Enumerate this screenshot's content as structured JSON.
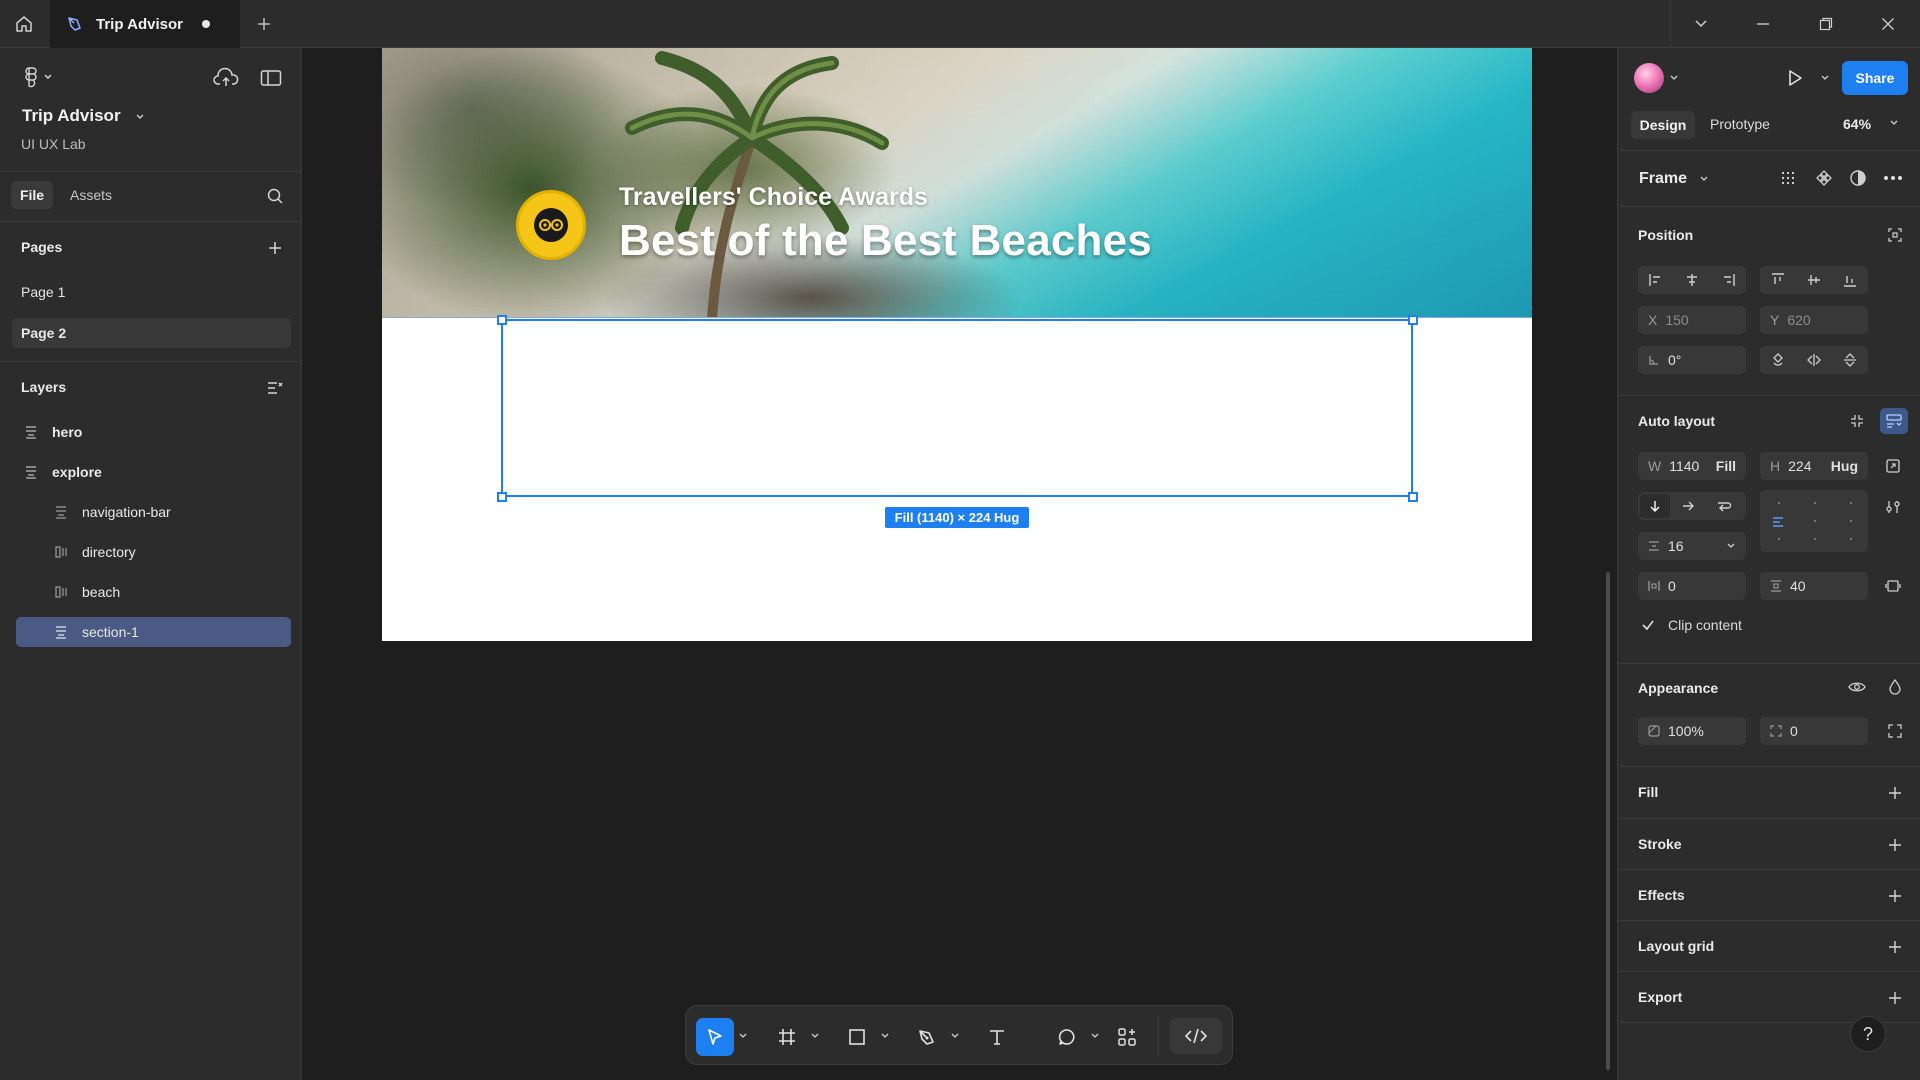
{
  "topbar": {
    "tab_title": "Trip Advisor"
  },
  "project": {
    "title": "Trip Advisor",
    "subtitle": "UI UX Lab",
    "tabs": [
      "File",
      "Assets"
    ]
  },
  "pages": {
    "title": "Pages",
    "items": [
      "Page 1",
      "Page 2"
    ],
    "active": "Page 2"
  },
  "layers": {
    "title": "Layers",
    "items": [
      {
        "label": "hero",
        "level": 0,
        "icon": "auto-layout-icon"
      },
      {
        "label": "explore",
        "level": 0,
        "icon": "auto-layout-icon"
      },
      {
        "label": "navigation-bar",
        "level": 1,
        "icon": "auto-layout-icon"
      },
      {
        "label": "directory",
        "level": 1,
        "icon": "vertical-layout-icon"
      },
      {
        "label": "beach",
        "level": 1,
        "icon": "vertical-layout-icon"
      },
      {
        "label": "section-1",
        "level": 1,
        "icon": "auto-layout-icon",
        "selected": true
      }
    ]
  },
  "canvas": {
    "hero_kicker": "Travellers' Choice Awards",
    "hero_title": "Best of the Best Beaches",
    "selection_label": "Fill (1140) × 224 Hug"
  },
  "right_panel": {
    "share_label": "Share",
    "tabs": [
      "Design",
      "Prototype"
    ],
    "zoom": "64%",
    "frame_label": "Frame",
    "position": {
      "title": "Position",
      "x_label": "X",
      "x_value": "150",
      "y_label": "Y",
      "y_value": "620",
      "rotation": "0°"
    },
    "auto_layout": {
      "title": "Auto layout",
      "w_label": "W",
      "w_value": "1140",
      "w_mode": "Fill",
      "h_label": "H",
      "h_value": "224",
      "h_mode": "Hug",
      "gap": "16",
      "padding_h": "0",
      "padding_v": "40",
      "clip_content": "Clip content"
    },
    "appearance": {
      "title": "Appearance",
      "opacity": "100%",
      "radius": "0"
    },
    "sections": [
      "Fill",
      "Stroke",
      "Effects",
      "Layout grid",
      "Export"
    ]
  },
  "colors": {
    "accent": "#1d7ff0",
    "panel": "#2c2c2c",
    "canvas": "#1e1e1e",
    "layer_selected": "#4a5a85",
    "badge_yellow": "#f5c518"
  }
}
